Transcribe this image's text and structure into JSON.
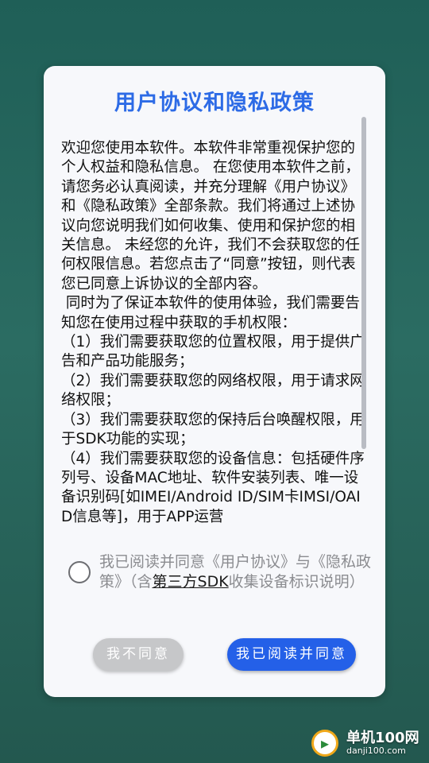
{
  "dialog": {
    "title": "用户协议和隐私政策",
    "paragraphs": [
      "欢迎您使用本软件。本软件非常重视保护您的个人权益和隐私信息。 在您使用本软件之前，请您务必认真阅读，并充分理解《用户协议》和《隐私政策》全部条款。我们将通过上述协议向您说明我们如何收集、使用和保护您的相关信息。 未经您的允许，我们不会获取您的任何权限信息。若您点击了“同意”按钮，则代表您已同意上诉协议的全部内容。",
      " 同时为了保证本软件的使用体验，我们需要告知您在使用过程中获取的手机权限：",
      "（1）我们需要获取您的位置权限，用于提供广告和产品功能服务；",
      "（2）我们需要获取您的网络权限，用于请求网络权限；",
      "（3）我们需要获取您的保持后台唤醒权限，用于SDK功能的实现；",
      "（4）我们需要获取您的设备信息：包括硬件序列号、设备MAC地址、软件安装列表、唯一设备识别码[如IMEI/Android ID/SIM卡IMSI/OAID信息等]，用于APP运营"
    ],
    "agreement": {
      "prefix": "我已阅读并同意《用户协议》与《隐私政策》（含",
      "link": "第三方SDK",
      "suffix": "收集设备标识说明）",
      "checked": false
    },
    "buttons": {
      "disagree": "我不同意",
      "agree": "我已阅读并同意"
    }
  },
  "watermark": {
    "icon": "play-icon",
    "name": "单机100网",
    "url": "danji100.com"
  },
  "colors": {
    "title": "#2d6be6",
    "agree_button": "#2460e8",
    "disagree_button": "#c6c7c9"
  }
}
